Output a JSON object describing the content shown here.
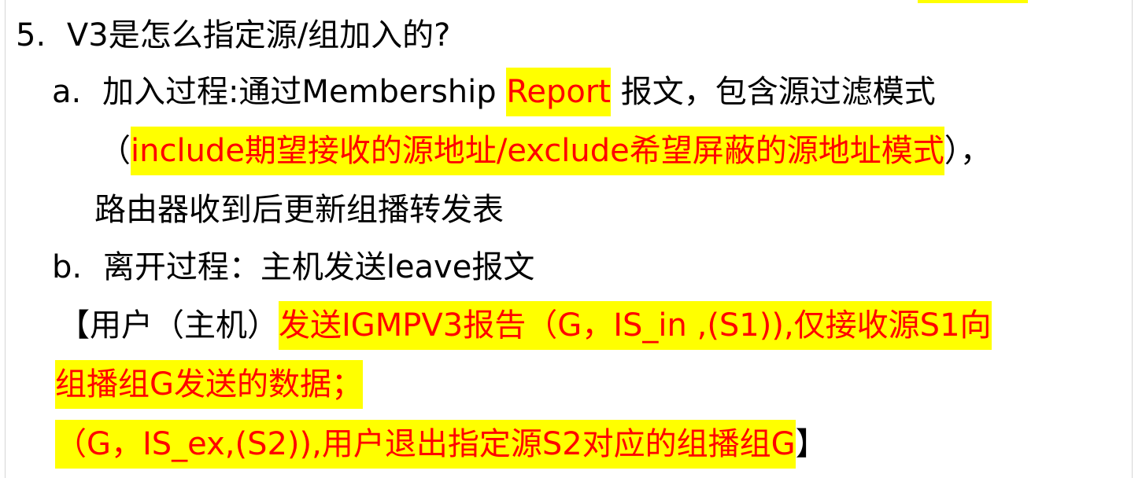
{
  "heading": {
    "number": "5.",
    "text": "V3是怎么指定源/组加入的?"
  },
  "item_a": {
    "marker": "a.",
    "line1_before": "加入过程:通过Membership ",
    "line1_highlight": "Report",
    "line1_after": " 报文，包含源过滤模式",
    "line2_open": "（",
    "line2_highlight": "include期望接收的源地址/exclude希望屏蔽的源地址模式",
    "line2_close": "），",
    "line3": "路由器收到后更新组播转发表"
  },
  "item_b": {
    "marker": "b.",
    "text": "离开过程：主机发送leave报文"
  },
  "example": {
    "line1_before": "【用户（主机）",
    "line1_highlight": "发送IGMPV3报告（G，IS_in ,(S1)),仅接收源S1向",
    "line2_highlight": "组播组G发送的数据；",
    "line3_highlight": "（G，IS_ex,(S2)),用户退出指定源S2对应的组播组G",
    "line3_after": "】"
  },
  "colors": {
    "highlight_background": "#ffff00",
    "highlight_text": "#ff0000",
    "body_text": "#000000"
  }
}
